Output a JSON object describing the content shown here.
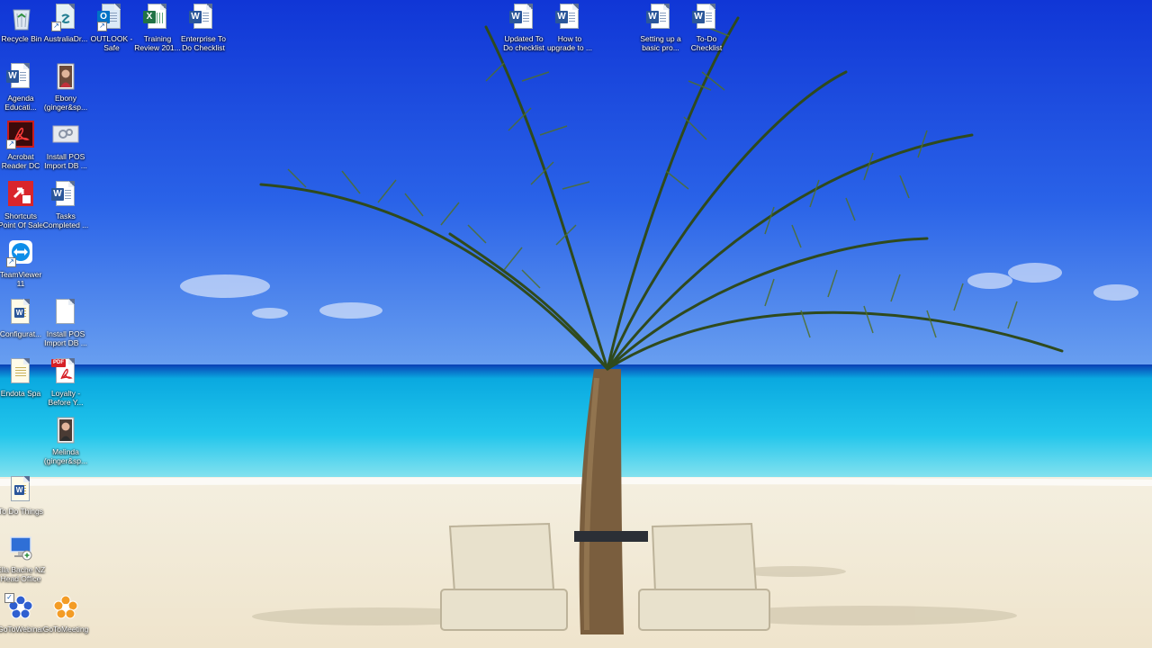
{
  "desktop": {
    "icons": [
      {
        "label": "Recycle Bin",
        "icon": "recycle-bin-icon"
      },
      {
        "label": "AustraliaDr...",
        "icon": "shortcut-app-icon"
      },
      {
        "label": "OUTLOOK -\nSafe",
        "icon": "outlook-icon"
      },
      {
        "label": "Training\nReview 201...",
        "icon": "excel-document-icon"
      },
      {
        "label": "Enterprise To\nDo Checklist",
        "icon": "word-document-icon"
      },
      {
        "label": "Updated To\nDo checklist",
        "icon": "word-document-icon"
      },
      {
        "label": "How to\nupgrade to ...",
        "icon": "word-document-icon"
      },
      {
        "label": "Setting up a\nbasic pro...",
        "icon": "word-document-icon"
      },
      {
        "label": "To-Do\nChecklist",
        "icon": "word-document-icon"
      },
      {
        "label": "Agenda\nEducati...",
        "icon": "word-document-icon"
      },
      {
        "label": "Ebony\n(ginger&sp...",
        "icon": "photo-icon"
      },
      {
        "label": "Acrobat\nReader DC",
        "icon": "acrobat-icon"
      },
      {
        "label": "Install POS\nImport DB ...",
        "icon": "installer-icon"
      },
      {
        "label": "Shortcuts\nPoint Of Sale",
        "icon": "shortcuts-icon"
      },
      {
        "label": "Tasks\nCompleted ...",
        "icon": "word-document-icon"
      },
      {
        "label": "TeamViewer\n11",
        "icon": "teamviewer-icon"
      },
      {
        "label": "Configurat...",
        "icon": "config-file-icon"
      },
      {
        "label": "Install POS\nImport DB ...",
        "icon": "blank-document-icon"
      },
      {
        "label": "Endota Spa",
        "icon": "config-file-icon"
      },
      {
        "label": "Loyalty -\nBefore Y...",
        "icon": "pdf-document-icon"
      },
      {
        "label": "Melinda\n(ginger&sp...",
        "icon": "photo-icon"
      },
      {
        "label": "To Do Things",
        "icon": "config-file-icon"
      },
      {
        "label": "Ella Bache NZ\nHead Office",
        "icon": "remote-desktop-icon"
      },
      {
        "label": "GoToWebinar",
        "icon": "gotowebinar-icon"
      },
      {
        "label": "GoToMeeting",
        "icon": "gotomeeting-icon"
      }
    ]
  }
}
